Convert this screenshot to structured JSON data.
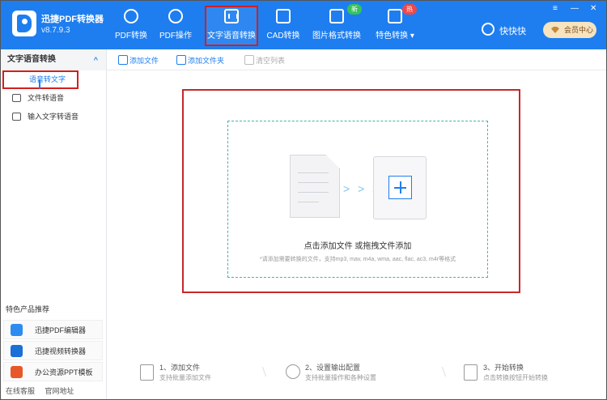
{
  "app": {
    "name": "迅捷PDF转换器",
    "version": "v8.7.9.3"
  },
  "nav": [
    {
      "label": "PDF转换"
    },
    {
      "label": "PDF操作"
    },
    {
      "label": "文字语音转换"
    },
    {
      "label": "CAD转换"
    },
    {
      "label": "图片格式转换",
      "badge": "新"
    },
    {
      "label": "特色转换 ▾",
      "badge": "热"
    }
  ],
  "user": {
    "name": "快快快",
    "vip_label": "会员中心"
  },
  "window_controls": {
    "menu": "≡",
    "minimize": "—",
    "close": "✕"
  },
  "sidebar": {
    "section_title": "文字语音转换",
    "collapse_glyph": "^",
    "items": [
      {
        "label": "语音转文字"
      },
      {
        "label": "文件转语音"
      },
      {
        "label": "输入文字转语音"
      }
    ],
    "featured_title": "特色产品推荐",
    "products": [
      {
        "label": "迅捷PDF编辑器",
        "color": "#2d8cf0"
      },
      {
        "label": "迅捷视频转换器",
        "color": "#1c6fd6"
      },
      {
        "label": "办公资源PPT模板",
        "color": "#e8572a"
      }
    ],
    "footer": {
      "online_service": "在线客服",
      "website": "官网地址"
    }
  },
  "toolbar": {
    "add_file": "添加文件",
    "add_folder": "添加文件夹",
    "clear_list": "清空列表"
  },
  "dropzone": {
    "title": "点击添加文件 或拖拽文件添加",
    "hint": "*请添加需要转换的文件，支持mp3, mav, m4a, wma, aac, flac, ac3, m4r等格式",
    "arrows": "> > >"
  },
  "steps": [
    {
      "title": "1、添加文件",
      "subtitle": "支持批量添加文件"
    },
    {
      "title": "2、设置输出配置",
      "subtitle": "支持批量操作和各种设置"
    },
    {
      "title": "3、开始转换",
      "subtitle": "点击转换按钮开始转换"
    }
  ],
  "colors": {
    "brand": "#1e7ef0",
    "highlight": "#d21f1f",
    "dashed_border": "#42b3b5"
  }
}
